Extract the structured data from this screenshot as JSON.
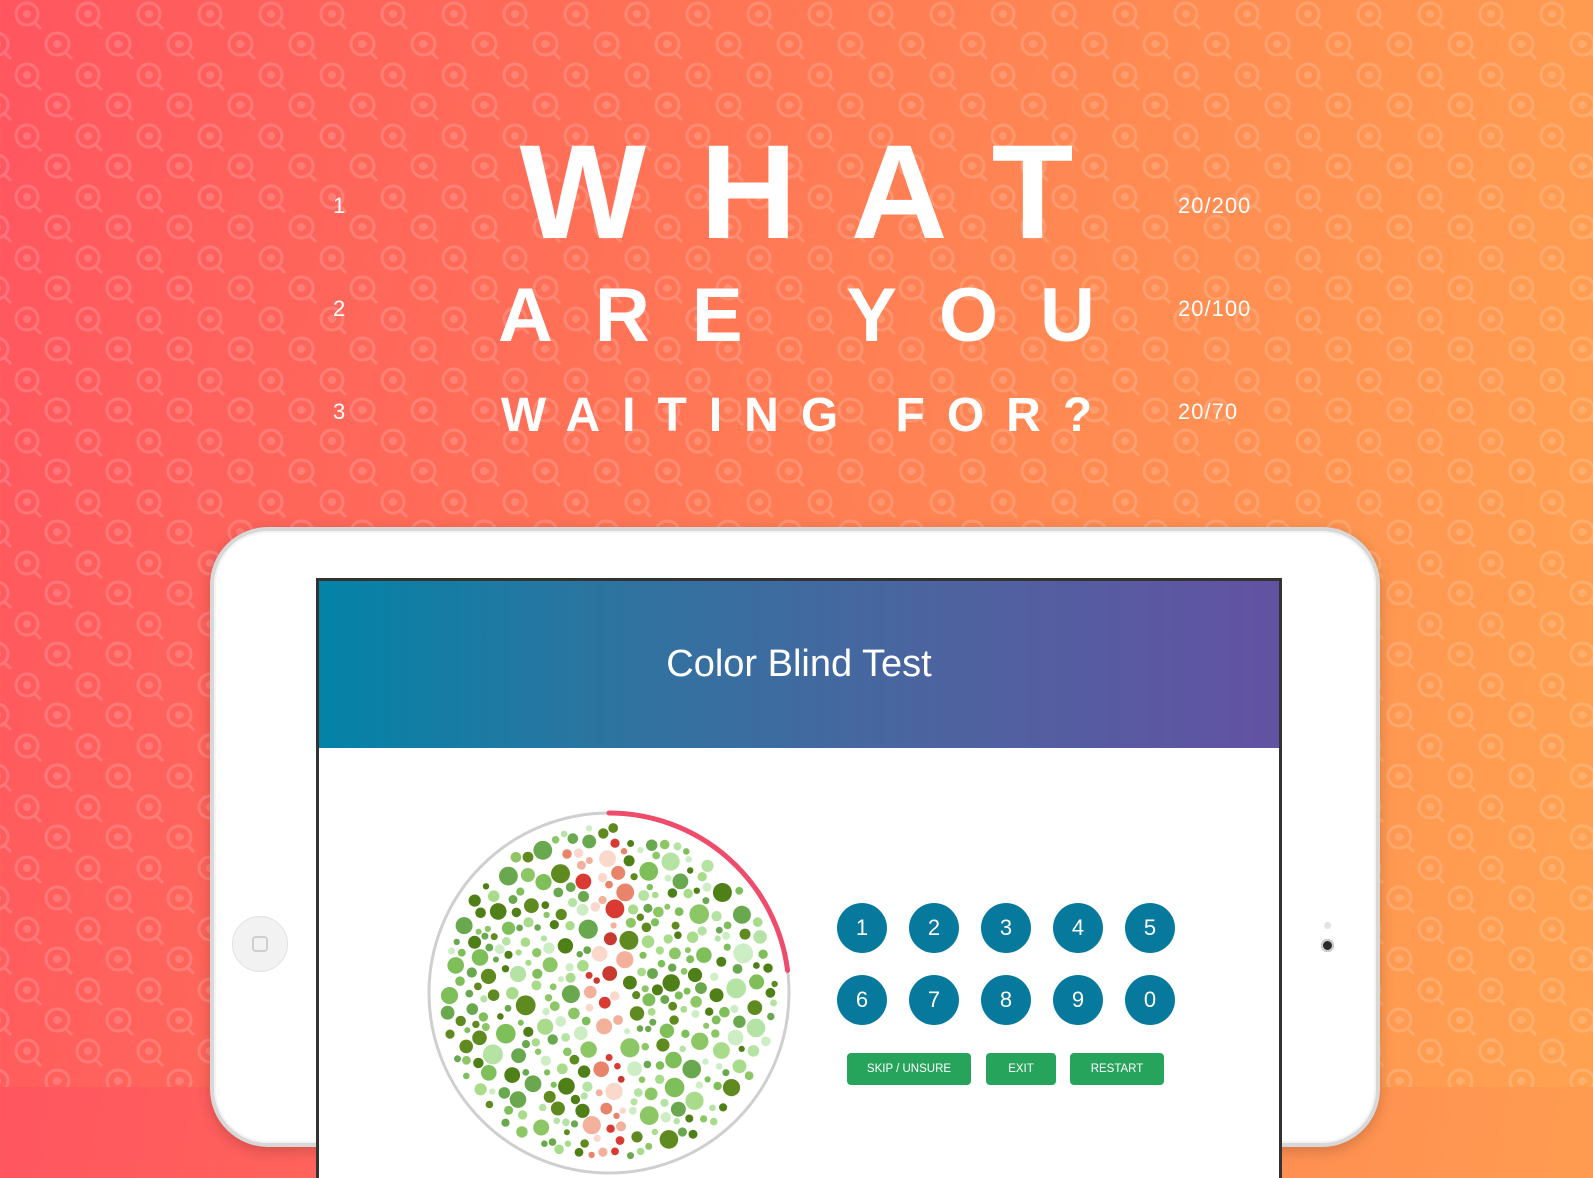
{
  "eye_chart": {
    "rows": [
      {
        "number": "1",
        "text": "WHAT",
        "acuity": "20/200"
      },
      {
        "number": "2",
        "text": "ARE YOU",
        "acuity": "20/100"
      },
      {
        "number": "3",
        "text": "WAITING FOR?",
        "acuity": "20/70"
      }
    ]
  },
  "background": {
    "gradient_start": "#ff5560",
    "gradient_end": "#ffa250",
    "pattern_icon": "eye-magnifier-icon"
  },
  "app": {
    "title": "Color Blind Test",
    "header_gradient": [
      "#0383a7",
      "#6352a2"
    ],
    "progress_ring_color": "#ef4b6b",
    "progress_fraction": 0.23,
    "plate_icon": "ishihara-plate-icon",
    "keypad": {
      "row1": [
        "1",
        "2",
        "3",
        "4",
        "5"
      ],
      "row2": [
        "6",
        "7",
        "8",
        "9",
        "0"
      ],
      "key_color": "#07799d"
    },
    "actions": {
      "skip": "SKIP / UNSURE",
      "exit": "EXIT",
      "restart": "RESTART",
      "color": "#27a45c"
    }
  }
}
